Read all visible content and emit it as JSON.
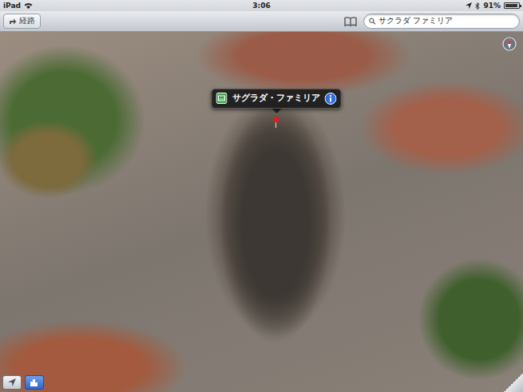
{
  "status_bar": {
    "device": "iPad",
    "time": "3:06",
    "battery": "91%",
    "battery_level": 0.91
  },
  "toolbar": {
    "directions_button": "経路",
    "search": {
      "value": "サクラダ ファミリア"
    }
  },
  "map": {
    "callout": {
      "title": "サグラダ・ファミリア"
    },
    "controls": [
      {
        "kind": "tracking",
        "selected": false
      },
      {
        "kind": "buildings",
        "selected": true
      }
    ]
  }
}
